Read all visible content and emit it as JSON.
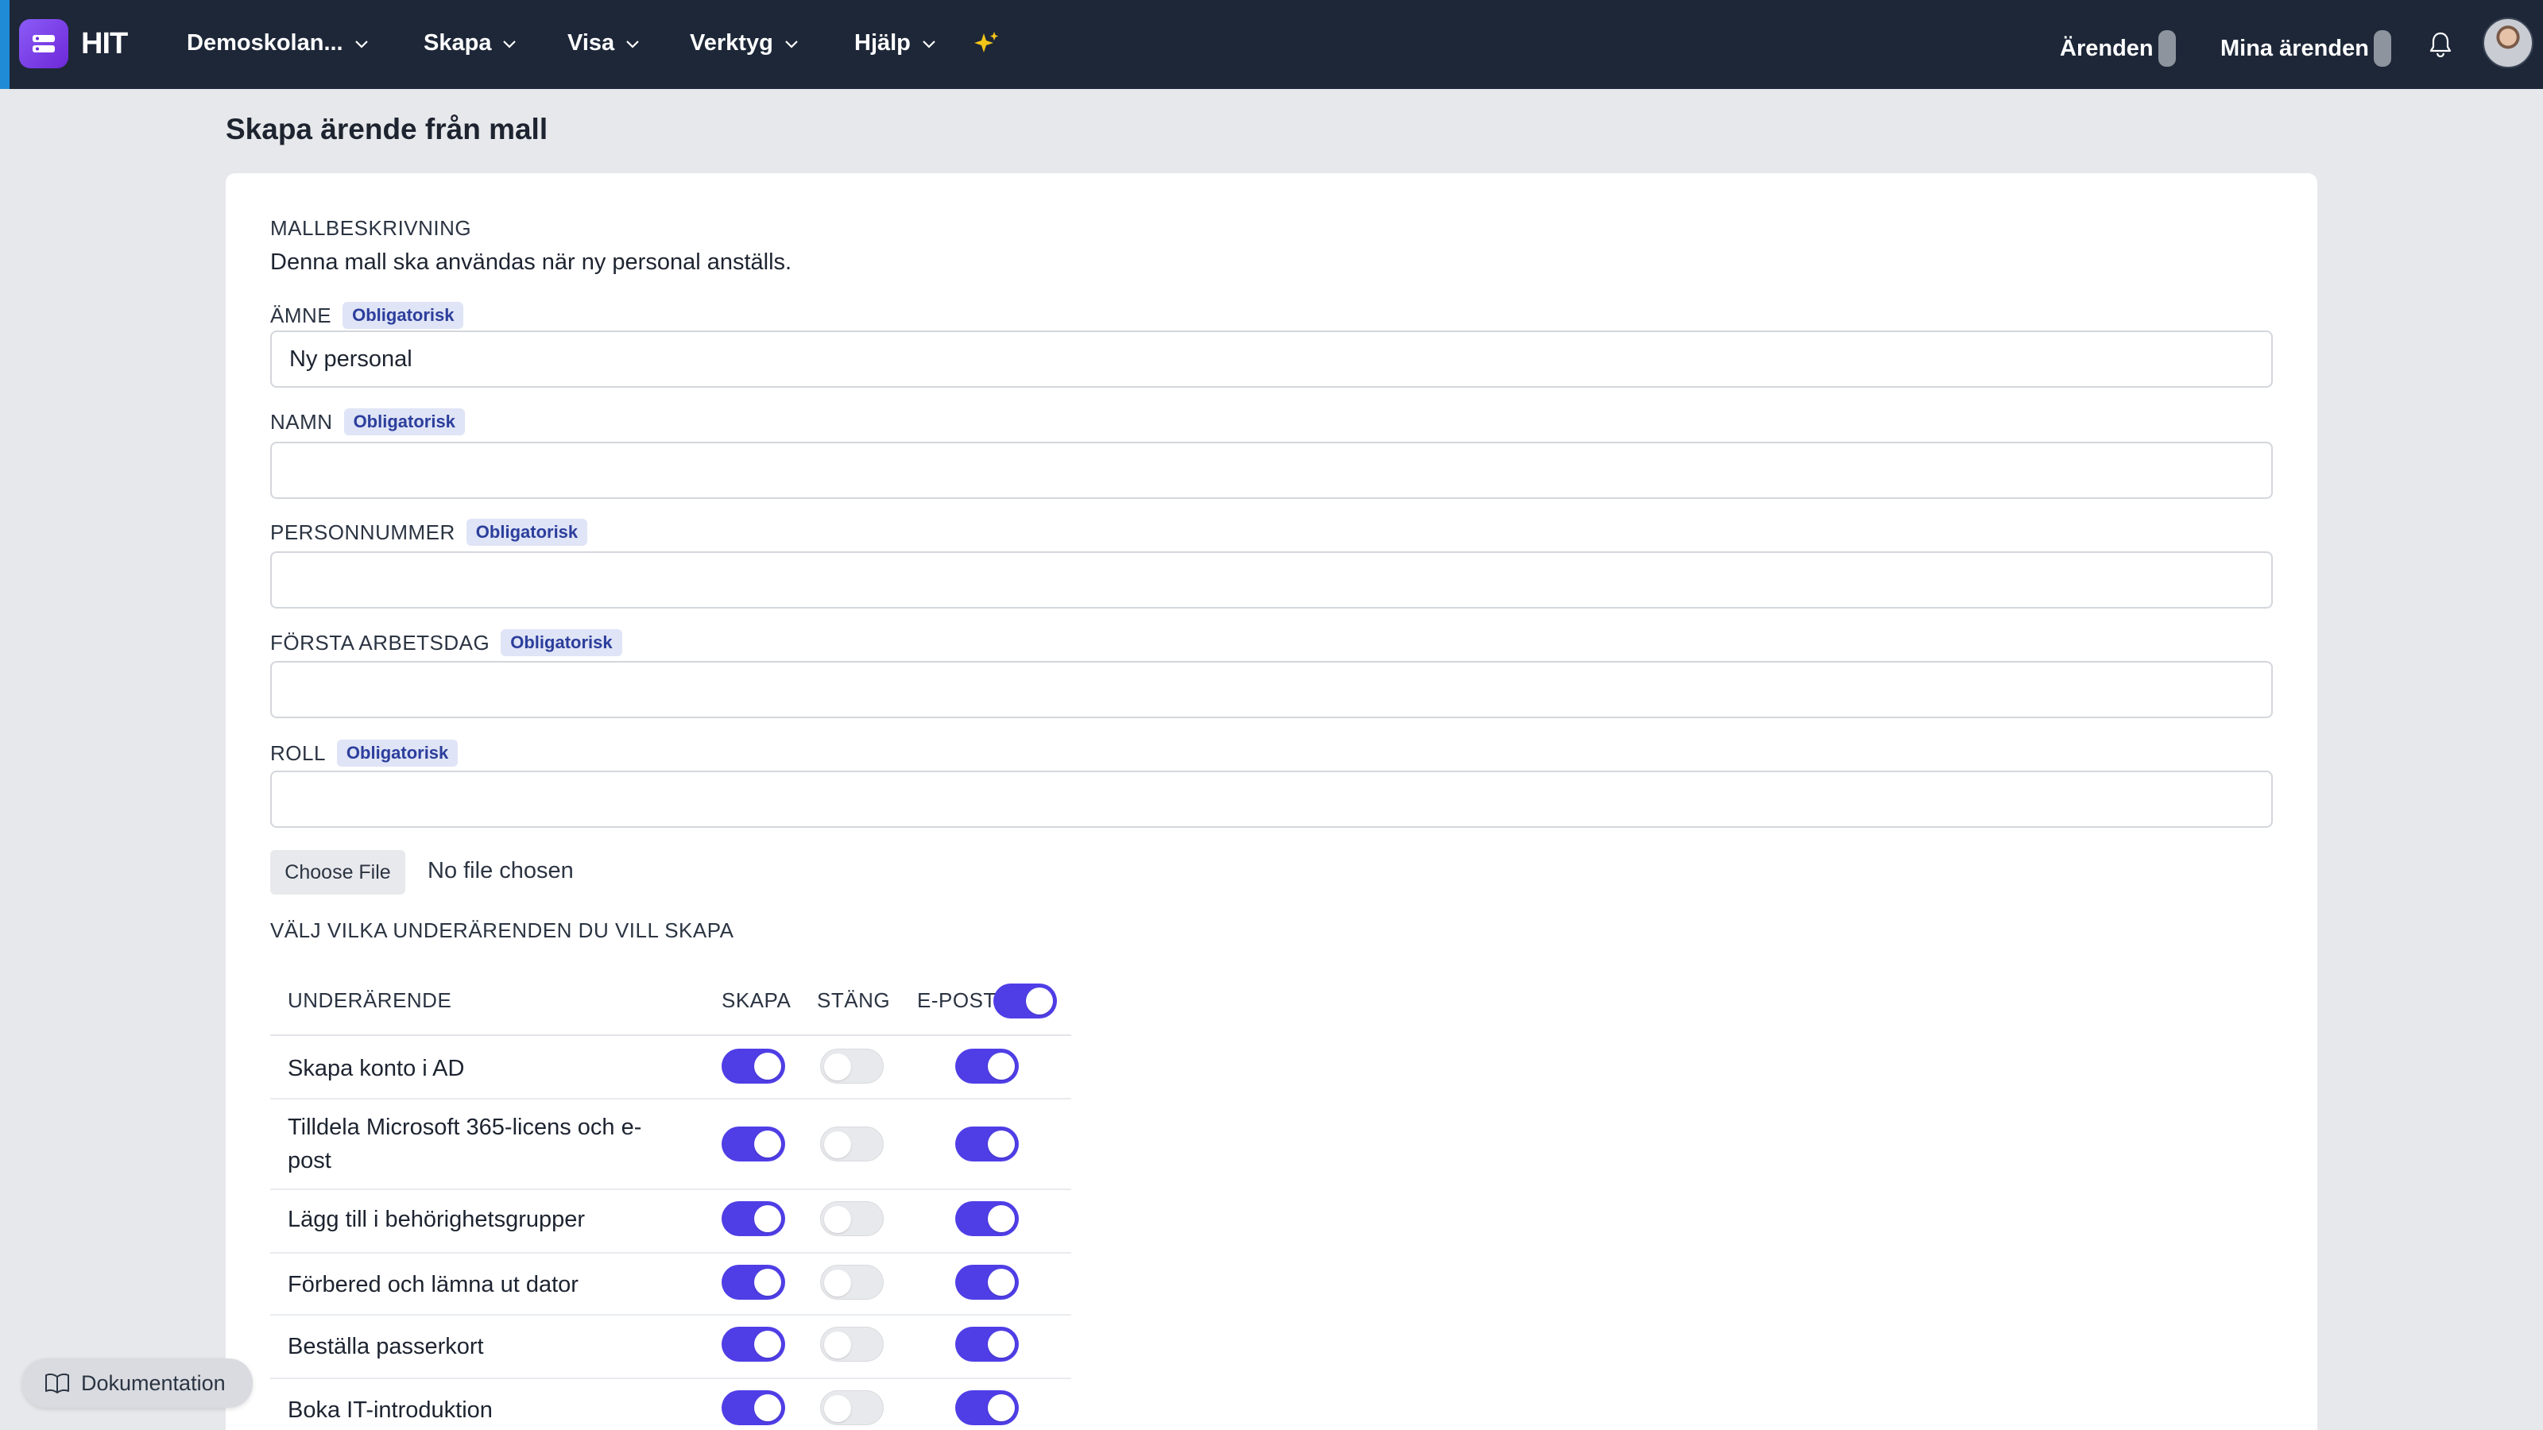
{
  "app": {
    "name": "HIT"
  },
  "nav": {
    "items": [
      {
        "label": "Demoskolan..."
      },
      {
        "label": "Skapa"
      },
      {
        "label": "Visa"
      },
      {
        "label": "Verktyg"
      },
      {
        "label": "Hjälp"
      }
    ],
    "right": {
      "arenden": "Ärenden",
      "mina_arenden": "Mina ärenden"
    }
  },
  "page": {
    "title": "Skapa ärende från mall"
  },
  "form": {
    "description_label": "MALLBESKRIVNING",
    "description": "Denna mall ska användas när ny personal anställs.",
    "required_badge": "Obligatorisk",
    "fields": [
      {
        "label": "ÄMNE",
        "value": "Ny personal"
      },
      {
        "label": "NAMN",
        "value": ""
      },
      {
        "label": "PERSONNUMMER",
        "value": ""
      },
      {
        "label": "FÖRSTA ARBETSDAG",
        "value": ""
      },
      {
        "label": "ROLL",
        "value": ""
      }
    ],
    "file": {
      "button": "Choose File",
      "status": "No file chosen"
    },
    "subtasks_label": "VÄLJ VILKA UNDERÄRENDEN DU VILL SKAPA"
  },
  "subtasks": {
    "headers": {
      "name": "UNDERÄRENDE",
      "create": "SKAPA",
      "close": "STÄNG",
      "email": "E-POST"
    },
    "email_all": true,
    "rows": [
      {
        "line1": "Skapa konto i AD",
        "line2": "",
        "create": true,
        "close": false,
        "email": true
      },
      {
        "line1": "Tilldela Microsoft 365-licens och e-",
        "line2": "post",
        "create": true,
        "close": false,
        "email": true
      },
      {
        "line1": "Lägg till i behörighetsgrupper",
        "line2": "",
        "create": true,
        "close": false,
        "email": true
      },
      {
        "line1": "Förbered och lämna ut dator",
        "line2": "",
        "create": true,
        "close": false,
        "email": true
      },
      {
        "line1": "Beställa passerkort",
        "line2": "",
        "create": true,
        "close": false,
        "email": true
      },
      {
        "line1": "Boka IT-introduktion",
        "line2": "",
        "create": true,
        "close": false,
        "email": true
      }
    ]
  },
  "docs": {
    "label": "Dokumentation"
  },
  "colors": {
    "nav_bg": "#1d2738",
    "toggle_on": "#4f3ee6",
    "badge_bg": "#dfe4f6",
    "page_bg": "#e7e8eb"
  }
}
